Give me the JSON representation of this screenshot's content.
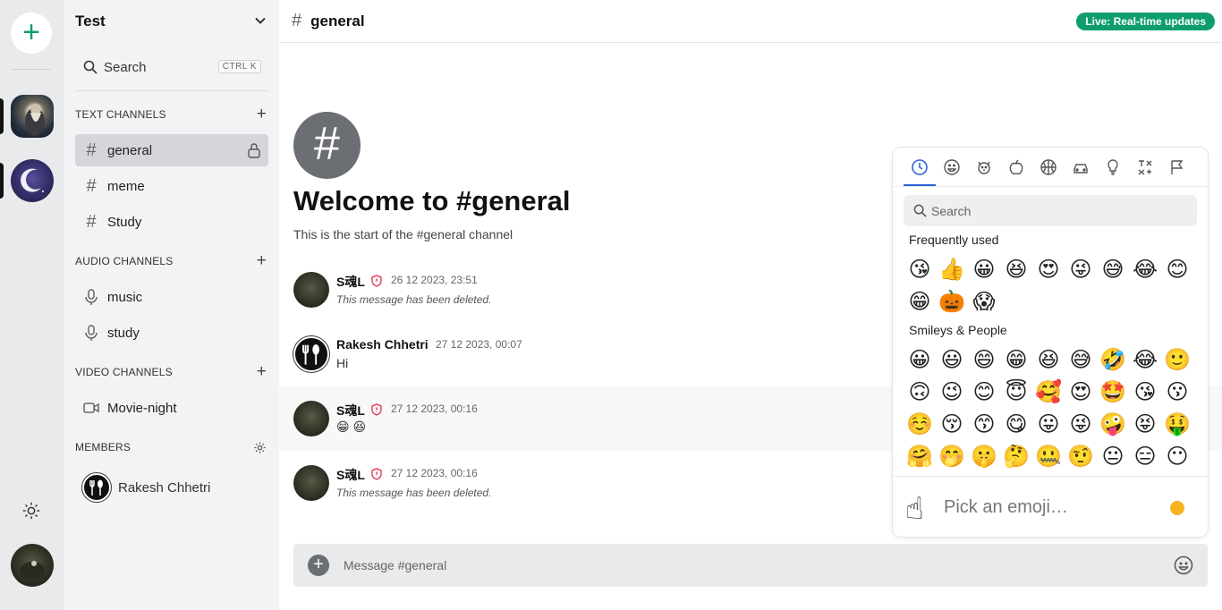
{
  "app": {
    "accent": "#0f9d70"
  },
  "rail": {
    "add_label": "+",
    "servers": [
      {
        "name": "server-wizard"
      },
      {
        "name": "server-moon"
      }
    ]
  },
  "sidebar": {
    "team_name": "Test",
    "search_label": "Search",
    "search_shortcut": "CTRL K",
    "sections": {
      "text": "TEXT CHANNELS",
      "audio": "AUDIO CHANNELS",
      "video": "VIDEO CHANNELS",
      "members": "MEMBERS"
    },
    "text_channels": [
      "general",
      "meme",
      "Study"
    ],
    "audio_channels": [
      "music",
      "study"
    ],
    "video_channels": [
      "Movie-night"
    ],
    "members": [
      "Rakesh Chhetri"
    ]
  },
  "header": {
    "hash": "#",
    "channel": "general",
    "live_badge": "Live: Real-time updates"
  },
  "welcome": {
    "icon": "#",
    "title": "Welcome to #general",
    "subtitle": "This is the start of the #general channel"
  },
  "messages": [
    {
      "author": "S魂L",
      "time": "26 12 2023, 23:51",
      "body": "This message has been deleted.",
      "deleted": true
    },
    {
      "author": "Rakesh Chhetri",
      "time": "27 12 2023, 00:07",
      "body": "Hi",
      "deleted": false
    },
    {
      "author": "S魂L",
      "time": "27 12 2023, 00:16",
      "body": "😁 😆",
      "deleted": false
    },
    {
      "author": "S魂L",
      "time": "27 12 2023, 00:16",
      "body": "This message has been deleted.",
      "deleted": true
    }
  ],
  "composer": {
    "placeholder": "Message #general"
  },
  "emoji_picker": {
    "search_placeholder": "Search",
    "categories": [
      "recent",
      "smileys",
      "animals",
      "food",
      "activity",
      "travel",
      "objects",
      "symbols",
      "flags"
    ],
    "frequent_title": "Frequently used",
    "frequent": [
      "😘",
      "👍",
      "😀",
      "😆",
      "😍",
      "😜",
      "😅",
      "😂",
      "😊",
      "😁",
      "🎃",
      "😱"
    ],
    "smileys_title": "Smileys & People",
    "smileys": [
      "😀",
      "😃",
      "😄",
      "😁",
      "😆",
      "😅",
      "🤣",
      "😂",
      "🙂",
      "🙃",
      "😉",
      "😊",
      "😇",
      "🥰",
      "😍",
      "🤩",
      "😘",
      "😗",
      "☺️",
      "😚",
      "😙",
      "😋",
      "😛",
      "😜",
      "🤪",
      "😝",
      "🤑",
      "🤗",
      "🤭",
      "🤫",
      "🤔",
      "🤐",
      "🤨",
      "😐",
      "😑",
      "😶"
    ],
    "footer_placeholder": "Pick an emoji…",
    "footer_emoji": "☝",
    "skin_tone_color": "#f6b321"
  }
}
